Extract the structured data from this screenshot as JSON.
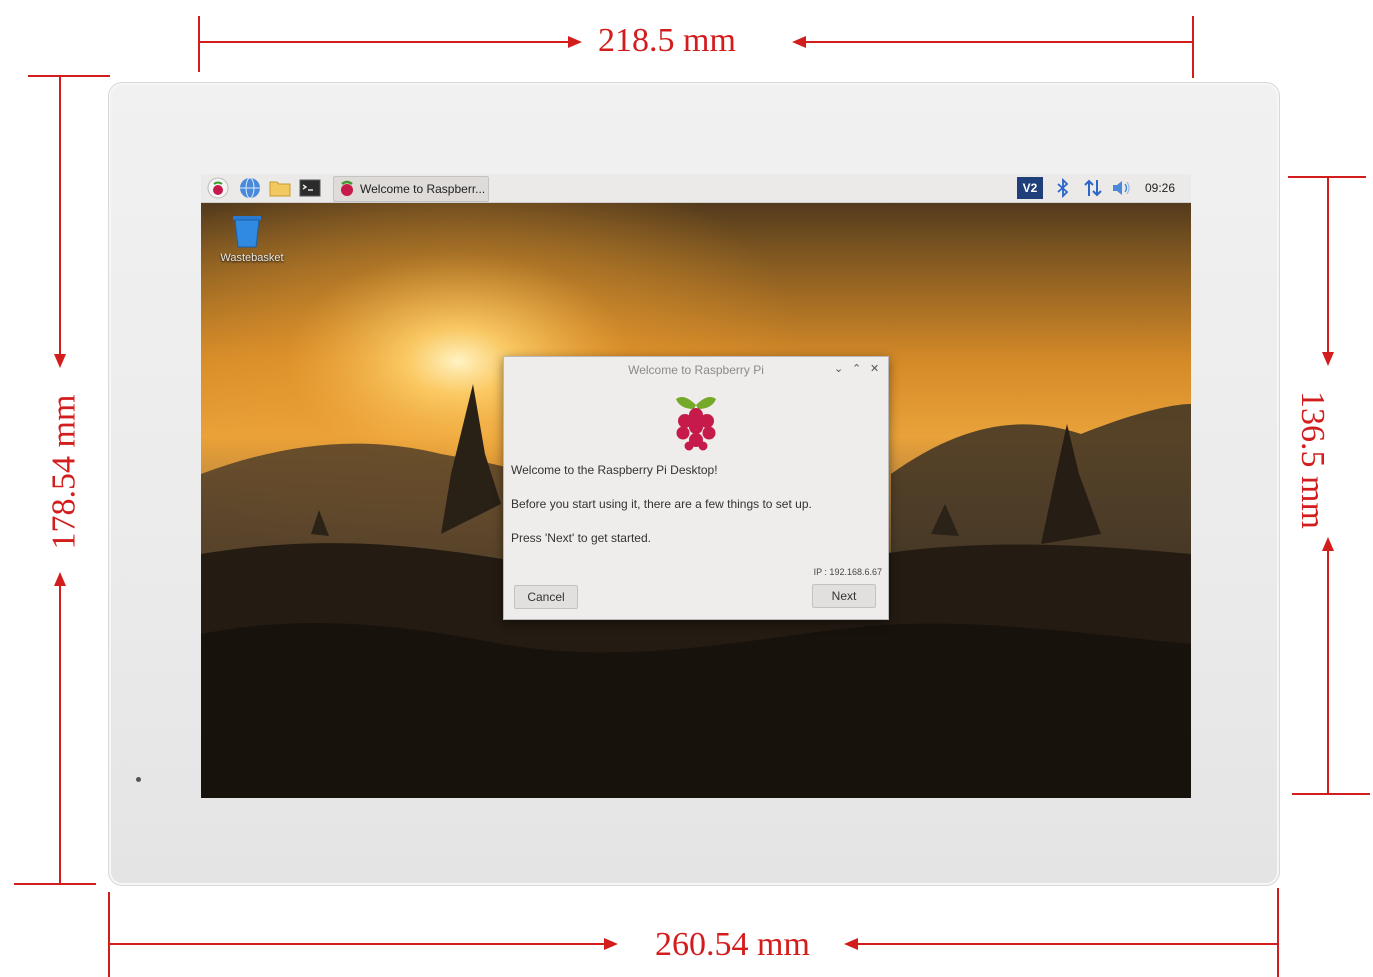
{
  "dimensions": {
    "top_width": "218.5 mm",
    "bottom_width": "260.54 mm",
    "left_height": "178.54 mm",
    "right_height": "136.5 mm",
    "annotation_color": "#d31c1c"
  },
  "taskbar": {
    "launcher_icons": [
      "raspberry-menu-icon",
      "web-browser-icon",
      "file-manager-icon",
      "terminal-icon"
    ],
    "active_task_label": "Welcome to Raspberr...",
    "tray": {
      "vnc_label": "V2",
      "icons": [
        "vnc-icon",
        "bluetooth-icon",
        "network-icon",
        "volume-icon"
      ],
      "clock": "09:26"
    }
  },
  "desktop": {
    "icons": [
      {
        "label": "Wastebasket",
        "icon": "wastebasket-icon"
      }
    ]
  },
  "dialog": {
    "title": "Welcome to Raspberry Pi",
    "controls": {
      "minimize": "⌄",
      "maximize": "⌃",
      "close": "✕"
    },
    "heading": "Welcome to the Raspberry Pi Desktop!",
    "line1": "Before you start using it, there are a few things to set up.",
    "line2": "Press 'Next' to get started.",
    "ip": "IP : 192.168.6.67",
    "cancel_label": "Cancel",
    "next_label": "Next"
  }
}
